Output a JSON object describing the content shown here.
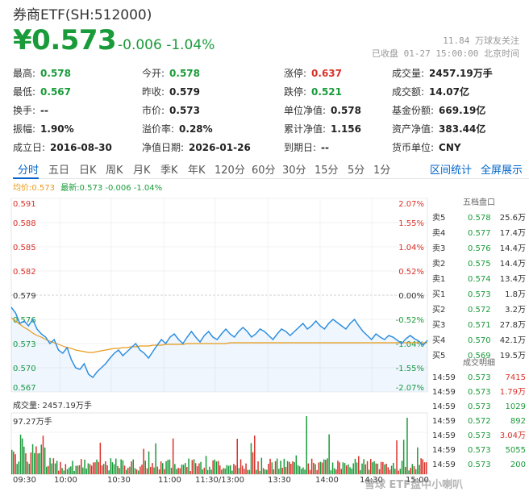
{
  "header": {
    "title": "券商ETF(SH:512000)",
    "price": "¥0.573",
    "change": "-0.006 -1.04%",
    "follow": "11.84 万球友关注",
    "status": "已收盘 01-27 15:00:00 北京时间"
  },
  "stats": [
    {
      "label": "最高:",
      "value": "0.578",
      "color": "green"
    },
    {
      "label": "今开:",
      "value": "0.578",
      "color": "green"
    },
    {
      "label": "涨停:",
      "value": "0.637",
      "color": "red"
    },
    {
      "label": "成交量:",
      "value": "2457.19万手",
      "color": ""
    },
    {
      "label": "最低:",
      "value": "0.567",
      "color": "green"
    },
    {
      "label": "昨收:",
      "value": "0.579",
      "color": ""
    },
    {
      "label": "跌停:",
      "value": "0.521",
      "color": "green"
    },
    {
      "label": "成交额:",
      "value": "14.07亿",
      "color": ""
    },
    {
      "label": "换手:",
      "value": "--",
      "color": ""
    },
    {
      "label": "市价:",
      "value": "0.573",
      "color": ""
    },
    {
      "label": "单位净值:",
      "value": "0.578",
      "color": ""
    },
    {
      "label": "基金份额:",
      "value": "669.19亿",
      "color": ""
    },
    {
      "label": "振幅:",
      "value": "1.90%",
      "color": ""
    },
    {
      "label": "溢价率:",
      "value": "0.28%",
      "color": ""
    },
    {
      "label": "累计净值:",
      "value": "1.156",
      "color": ""
    },
    {
      "label": "资产净值:",
      "value": "383.44亿",
      "color": ""
    },
    {
      "label": "成立日:",
      "value": "2016-08-30",
      "color": ""
    },
    {
      "label": "净值日期:",
      "value": "2026-01-26",
      "color": ""
    },
    {
      "label": "到期日:",
      "value": "--",
      "color": ""
    },
    {
      "label": "货币单位:",
      "value": "CNY",
      "color": ""
    }
  ],
  "tabs": [
    "分时",
    "五日",
    "日K",
    "周K",
    "月K",
    "季K",
    "年K",
    "120分",
    "60分",
    "30分",
    "15分",
    "5分",
    "1分"
  ],
  "tab_links": [
    "区间统计",
    "全屏展示"
  ],
  "legend": {
    "avg": "均价:0.573",
    "last": "最新:0.573 -0.006 -1.04%"
  },
  "colors": {
    "up": "#d9322a",
    "down": "#1a9b3a",
    "price_line": "#2f8fe0",
    "avg_line": "#e89a1a"
  },
  "order_book": {
    "title": "五档盘口",
    "rows": [
      {
        "label": "卖5",
        "price": "0.578",
        "vol": "25.6万"
      },
      {
        "label": "卖4",
        "price": "0.577",
        "vol": "17.4万"
      },
      {
        "label": "卖3",
        "price": "0.576",
        "vol": "14.4万"
      },
      {
        "label": "卖2",
        "price": "0.575",
        "vol": "14.4万"
      },
      {
        "label": "卖1",
        "price": "0.574",
        "vol": "13.4万"
      },
      {
        "label": "买1",
        "price": "0.573",
        "vol": "1.8万"
      },
      {
        "label": "买2",
        "price": "0.572",
        "vol": "3.2万"
      },
      {
        "label": "买3",
        "price": "0.571",
        "vol": "27.8万"
      },
      {
        "label": "买4",
        "price": "0.570",
        "vol": "42.1万"
      },
      {
        "label": "买5",
        "price": "0.569",
        "vol": "19.5万"
      }
    ]
  },
  "trades": {
    "title": "成交明细",
    "rows": [
      {
        "time": "14:59",
        "price": "0.573",
        "vol": "7415",
        "color": "red"
      },
      {
        "time": "14:59",
        "price": "0.573",
        "vol": "1.79万",
        "color": "red"
      },
      {
        "time": "14:59",
        "price": "0.573",
        "vol": "1029",
        "color": "green"
      },
      {
        "time": "14:59",
        "price": "0.572",
        "vol": "892",
        "color": "green"
      },
      {
        "time": "14:59",
        "price": "0.573",
        "vol": "3.04万",
        "color": "red"
      },
      {
        "time": "14:59",
        "price": "0.573",
        "vol": "5055",
        "color": "green"
      },
      {
        "time": "14:59",
        "price": "0.573",
        "vol": "200",
        "color": "green"
      }
    ]
  },
  "volume": {
    "label": "成交量: 2457.19万手",
    "max": "97.27万手"
  },
  "x_axis": [
    "09:30",
    "10:00",
    "10:30",
    "11:00",
    "11:30/13:00",
    "13:30",
    "14:00",
    "14:30",
    "15:00"
  ],
  "watermark": "雪球 ETF盘中小喇叭",
  "chart_data": {
    "type": "line",
    "prev_close": 0.579,
    "ylim": [
      0.567,
      0.591
    ],
    "price_ticks": [
      "0.591",
      "0.588",
      "0.585",
      "0.582",
      "0.579",
      "0.576",
      "0.573",
      "0.570",
      "0.567"
    ],
    "pct_ticks": [
      "2.07%",
      "1.55%",
      "1.04%",
      "0.52%",
      "0.00%",
      "-0.52%",
      "-1.04%",
      "-1.55%",
      "-2.07%"
    ],
    "series": [
      {
        "values": [
          0.5775,
          0.5768,
          0.5755,
          0.5758,
          0.5752,
          0.576,
          0.5748,
          0.5742,
          0.5738,
          0.573,
          0.5735,
          0.5722,
          0.5718,
          0.5725,
          0.571,
          0.57,
          0.5698,
          0.5705,
          0.5692,
          0.5688,
          0.5695,
          0.57,
          0.5705,
          0.5712,
          0.5718,
          0.5722,
          0.5715,
          0.572,
          0.5725,
          0.573,
          0.5722,
          0.5718,
          0.5712,
          0.572,
          0.5728,
          0.5735,
          0.573,
          0.5738,
          0.5742,
          0.5735,
          0.573,
          0.5738,
          0.5745,
          0.5738,
          0.5732,
          0.574,
          0.5745,
          0.5738,
          0.5735,
          0.5742,
          0.5748,
          0.5742,
          0.5738,
          0.5745,
          0.575,
          0.5745,
          0.5738,
          0.5742,
          0.5748,
          0.5745,
          0.574,
          0.5735,
          0.5742,
          0.5748,
          0.5745,
          0.574,
          0.5745,
          0.575,
          0.5755,
          0.5748,
          0.5752,
          0.5758,
          0.5752,
          0.5748,
          0.5755,
          0.576,
          0.5756,
          0.5752,
          0.5748,
          0.5755,
          0.576,
          0.5752,
          0.5745,
          0.574,
          0.5735,
          0.5742,
          0.5738,
          0.5735,
          0.574,
          0.5738,
          0.5734,
          0.573,
          0.5736,
          0.574,
          0.5736,
          0.5733,
          0.5728,
          0.5734
        ]
      },
      {
        "values": [
          0.5762,
          0.5758,
          0.5754,
          0.575,
          0.5747,
          0.5743,
          0.574,
          0.5738,
          0.5735,
          0.5733,
          0.5731,
          0.5729,
          0.5727,
          0.5725,
          0.5724,
          0.5722,
          0.5721,
          0.572,
          0.5719,
          0.5719,
          0.572,
          0.5721,
          0.5722,
          0.5723,
          0.5724,
          0.5724,
          0.5725,
          0.5725,
          0.5726,
          0.5726,
          0.5727,
          0.5727,
          0.5727,
          0.5728,
          0.5728,
          0.5728,
          0.5729,
          0.5729,
          0.5729,
          0.5729,
          0.5729,
          0.573,
          0.573,
          0.573,
          0.573,
          0.573,
          0.573,
          0.573,
          0.573,
          0.573,
          0.573,
          0.5731,
          0.5731,
          0.5731,
          0.5731,
          0.5731,
          0.5731,
          0.5731,
          0.5731,
          0.5731,
          0.5731,
          0.5731,
          0.5731,
          0.5731,
          0.5731,
          0.5731,
          0.5731,
          0.5731,
          0.5731,
          0.5731,
          0.5731,
          0.5731,
          0.5731,
          0.5731,
          0.5731,
          0.5731,
          0.5731,
          0.5731,
          0.5731,
          0.5731,
          0.5731,
          0.5731,
          0.5731,
          0.5731,
          0.5731,
          0.5731,
          0.5731,
          0.5731,
          0.5731,
          0.5731,
          0.5731,
          0.5731,
          0.5731,
          0.5731,
          0.5731,
          0.5731,
          0.5731,
          0.5731
        ]
      }
    ]
  }
}
